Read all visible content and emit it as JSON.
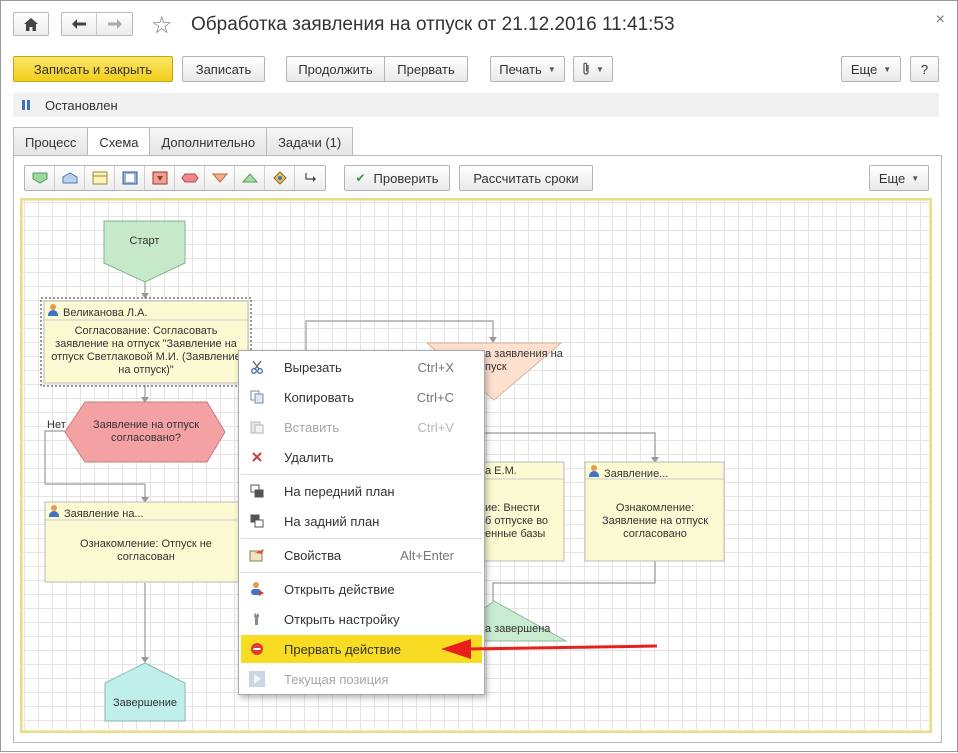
{
  "window": {
    "title": "Обработка заявления на отпуск от 21.12.2016 11:41:53",
    "close_glyph": "×"
  },
  "toolbar": {
    "save_close": "Записать и закрыть",
    "save": "Записать",
    "continue": "Продолжить",
    "interrupt": "Прервать",
    "print": "Печать",
    "more": "Еще",
    "help": "?"
  },
  "status": {
    "text": "Остановлен"
  },
  "tabs": [
    {
      "label": "Процесс",
      "active": false
    },
    {
      "label": "Схема",
      "active": true
    },
    {
      "label": "Дополнительно",
      "active": false
    },
    {
      "label": "Задачи (1)",
      "active": false
    }
  ],
  "scheme_toolbar": {
    "check": "Проверить",
    "calc_deadlines": "Рассчитать сроки",
    "more": "Еще"
  },
  "diagram": {
    "start": "Старт",
    "task1": {
      "assignee": "Великанова Л.А.",
      "text": "Согласование: Согласовать заявление на отпуск \"Заявление на отпуск Светлаковой М.И. (Заявление на отпуск)\""
    },
    "condition": "Заявление на отпуск согласовано?",
    "no_label": "Нет",
    "task_left": {
      "assignee": "Заявление  на...",
      "text": "Ознакомление: Отпуск не согласован"
    },
    "finish": "Завершение",
    "triangle_text_1": "а заявления на",
    "triangle_text_2": "пуск",
    "task_mid": {
      "assignee": "а Е.М.",
      "text_1": "ие: Внести",
      "text_2": "б отпуске во",
      "text_3": "енные базы"
    },
    "task_right": {
      "assignee": "Заявление...",
      "text": "Ознакомление: Заявление на отпуск согласовано"
    },
    "end_text": "а завершена"
  },
  "context_menu": {
    "items": [
      {
        "label": "Вырезать",
        "shortcut": "Ctrl+X",
        "icon": "scissors-icon",
        "disabled": false
      },
      {
        "label": "Копировать",
        "shortcut": "Ctrl+C",
        "icon": "copy-icon",
        "disabled": false
      },
      {
        "label": "Вставить",
        "shortcut": "Ctrl+V",
        "icon": "paste-icon",
        "disabled": true
      },
      {
        "label": "Удалить",
        "shortcut": "",
        "icon": "delete-icon",
        "disabled": false
      },
      {
        "label": "На передний план",
        "shortcut": "",
        "icon": "bring-front-icon",
        "disabled": false
      },
      {
        "label": "На задний план",
        "shortcut": "",
        "icon": "send-back-icon",
        "disabled": false
      },
      {
        "label": "Свойства",
        "shortcut": "Alt+Enter",
        "icon": "properties-icon",
        "disabled": false
      },
      {
        "label": "Открыть действие",
        "shortcut": "",
        "icon": "open-action-icon",
        "disabled": false
      },
      {
        "label": "Открыть настройку",
        "shortcut": "",
        "icon": "wrench-icon",
        "disabled": false
      },
      {
        "label": "Прервать действие",
        "shortcut": "",
        "icon": "stop-icon",
        "disabled": false,
        "highlighted": true
      },
      {
        "label": "Текущая позиция",
        "shortcut": "",
        "icon": "play-icon",
        "disabled": true
      }
    ]
  },
  "colors": {
    "primary_button": "#f2cd1a",
    "highlight": "#f8dc23",
    "annotation_arrow": "#e8201c",
    "start_node": "#c6eac9",
    "condition_node": "#f4a1a3",
    "finish_node": "#bfeeeb",
    "task_fill": "#fbfad2"
  }
}
